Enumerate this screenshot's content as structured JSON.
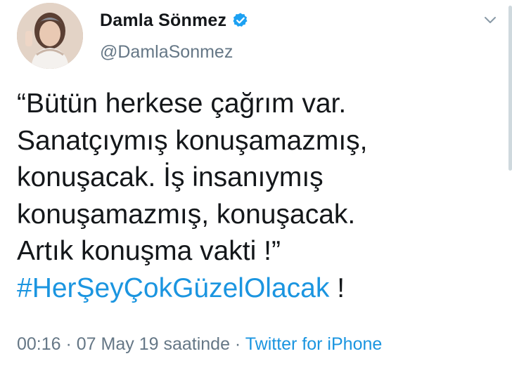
{
  "user": {
    "display_name": "Damla Sönmez",
    "handle": "@DamlaSonmez",
    "verified_icon": "verified-badge-icon",
    "avatar": "profile-photo"
  },
  "menu_icon": "chevron-down-icon",
  "tweet": {
    "lines": [
      "“Bütün herkese çağrım var.",
      "Sanatçıymış konuşamazmış,",
      "konuşacak. İş insanıymış",
      "konuşamazmış, konuşacak.",
      "Artık konuşma vakti !”"
    ],
    "hashtag": "#HerŞeyÇokGüzelOlacak",
    "hashtag_suffix": " !"
  },
  "meta": {
    "time": "00:16",
    "separator": " · ",
    "date": "07 May 19 saatinde",
    "separator2": " · ",
    "source": "Twitter for iPhone"
  },
  "colors": {
    "link": "#1b95e0",
    "secondary_text": "#657786",
    "primary_text": "#14171a"
  }
}
